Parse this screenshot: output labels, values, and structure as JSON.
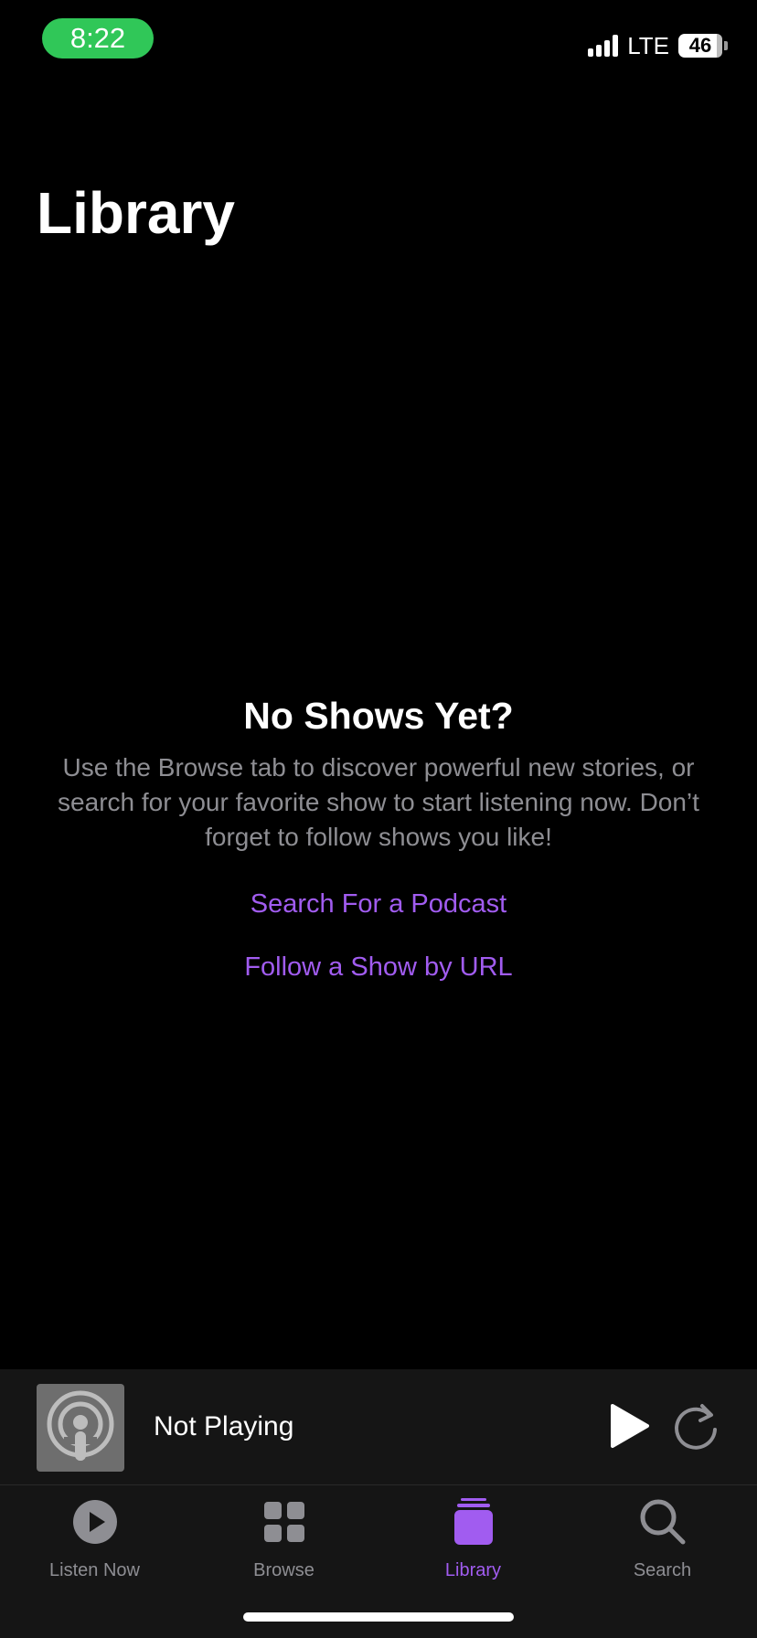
{
  "status_bar": {
    "time": "8:22",
    "network": "LTE",
    "battery": "46"
  },
  "page": {
    "title": "Library"
  },
  "empty_state": {
    "title": "No Shows Yet?",
    "description": "Use the Browse tab to discover powerful new stories, or search for your favorite show to start listening now. Don’t forget to follow shows you like!",
    "search_link": "Search For a Podcast",
    "url_link": "Follow a Show by URL"
  },
  "mini_player": {
    "status": "Not Playing"
  },
  "tab_bar": {
    "tabs": [
      {
        "label": "Listen Now",
        "icon": "play-circle-icon",
        "active": false
      },
      {
        "label": "Browse",
        "icon": "grid-icon",
        "active": false
      },
      {
        "label": "Library",
        "icon": "library-stack-icon",
        "active": true
      },
      {
        "label": "Search",
        "icon": "search-icon",
        "active": false
      }
    ]
  },
  "colors": {
    "accent": "#a15cf0",
    "status_pill": "#30c758",
    "secondary_text": "#8e8e93"
  }
}
